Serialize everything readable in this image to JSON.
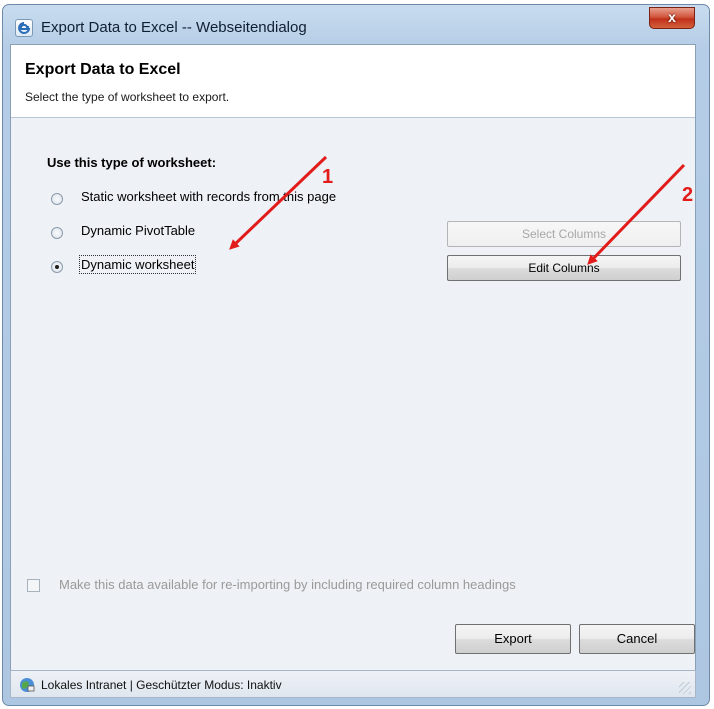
{
  "window": {
    "title": "Export Data to Excel -- Webseitendialog",
    "close_label": "x"
  },
  "header": {
    "title": "Export Data to Excel",
    "subtitle": "Select the type of worksheet to export."
  },
  "worksheet": {
    "section_label": "Use this type of worksheet:",
    "options": [
      {
        "label": "Static worksheet with records from this page",
        "checked": false
      },
      {
        "label": "Dynamic PivotTable",
        "checked": false
      },
      {
        "label": "Dynamic worksheet",
        "checked": true
      }
    ]
  },
  "buttons": {
    "select_columns": "Select Columns",
    "edit_columns": "Edit Columns",
    "export": "Export",
    "cancel": "Cancel"
  },
  "reimport": {
    "label": "Make this data available for re-importing by including required column headings",
    "checked": false
  },
  "status": {
    "text": "Lokales Intranet | Geschützter Modus: Inaktiv"
  },
  "annotations": {
    "marker_1": "1",
    "marker_2": "2",
    "color": "#e21b1b"
  }
}
